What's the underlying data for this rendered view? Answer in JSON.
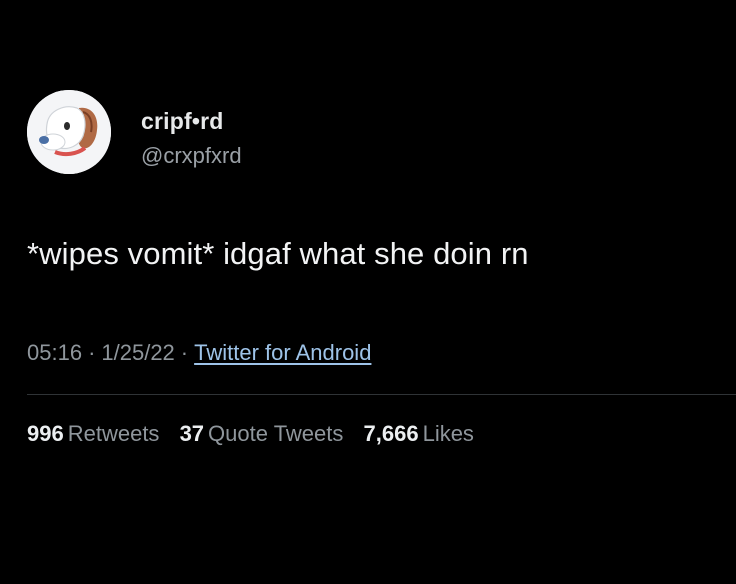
{
  "author": {
    "display_name": "cripf•rd",
    "handle": "@crxpfxrd",
    "avatar_icon": "dog-avatar-icon"
  },
  "tweet": {
    "text": "*wipes vomit* idgaf what she doin rn",
    "time": "05:16",
    "date": "1/25/22",
    "separator": "·",
    "source": "Twitter for Android"
  },
  "stats": {
    "retweets_count": "996",
    "retweets_label": "Retweets",
    "quote_tweets_count": "37",
    "quote_tweets_label": "Quote Tweets",
    "likes_count": "7,666",
    "likes_label": "Likes"
  },
  "colors": {
    "background": "#000000",
    "text": "#e7e9ea",
    "secondary_text": "#8f969c",
    "link": "#9ec3e8",
    "divider": "#2f3336"
  }
}
